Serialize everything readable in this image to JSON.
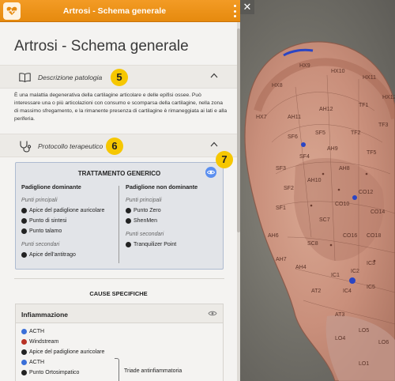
{
  "window": {
    "title": "Artrosi - Schema generale"
  },
  "page": {
    "title": "Artrosi - Schema generale"
  },
  "pathology": {
    "header_label": "Descrizione patologia",
    "badge": "5",
    "text": "È una malattia degenerativa della cartilagine articolare e delle epifisi ossee. Può interessare una o più articolazioni con consumo e scomparsa della cartilagine, nella zona di massimo sfregamento, e la rimanente presenza di cartilagine è rimaneggiata ai lati e alla periferia."
  },
  "protocol": {
    "header_label": "Protocollo terapeutico",
    "badge": "6"
  },
  "treatment": {
    "title": "TRATTAMENTO GENERICO",
    "badge": "7",
    "dominant": {
      "title": "Padiglione dominante",
      "primary_label": "Punti principali",
      "primary": [
        "Apice del padiglione auricolare",
        "Punto di sintesi",
        "Punto talamo"
      ],
      "secondary_label": "Punti secondari",
      "secondary": [
        "Apice dell'antitrago"
      ]
    },
    "non_dominant": {
      "title": "Padiglione non dominante",
      "primary_label": "Punti principali",
      "primary": [
        "Punto Zero",
        "ShenMen"
      ],
      "secondary_label": "Punti secondari",
      "secondary": [
        "Tranquilizer Point"
      ]
    }
  },
  "specific": {
    "title": "CAUSE SPECIFICHE",
    "inflammation": {
      "title": "Infiammazione",
      "items": [
        {
          "label": "ACTH",
          "color": "#3a6fd8"
        },
        {
          "label": "Windstream",
          "color": "#b83224"
        },
        {
          "label": "Apice del padiglione auricolare",
          "color": "#222222"
        },
        {
          "label": "ACTH",
          "color": "#3a6fd8"
        },
        {
          "label": "Punto Ortosimpatico",
          "color": "#222222"
        }
      ],
      "group_label": "Triade antinfiammatoria"
    }
  },
  "ear_labels": [
    "HX9",
    "HX10",
    "HX11",
    "HX8",
    "HX12",
    "HX6",
    "HX7",
    "AH11",
    "AH12",
    "AH6",
    "AH7",
    "AH4",
    "TF1",
    "TF2",
    "TF3",
    "TF5",
    "SF1",
    "SF2",
    "SF3",
    "SF4",
    "SF5",
    "SF6",
    "CO10",
    "CO12",
    "CO14",
    "CO16",
    "CO18",
    "SC7",
    "SC8",
    "AH8",
    "AH9",
    "AH10",
    "AT2",
    "AT3",
    "LO4",
    "LO5",
    "LO6",
    "LO1",
    "IC1",
    "IC2",
    "IC3",
    "IC4",
    "IC5"
  ],
  "colors": {
    "titlebar": "#e68a0e",
    "badge": "#f6c700",
    "eye_active": "#5b8ff0",
    "ear_point_blue": "#2a45c4"
  }
}
